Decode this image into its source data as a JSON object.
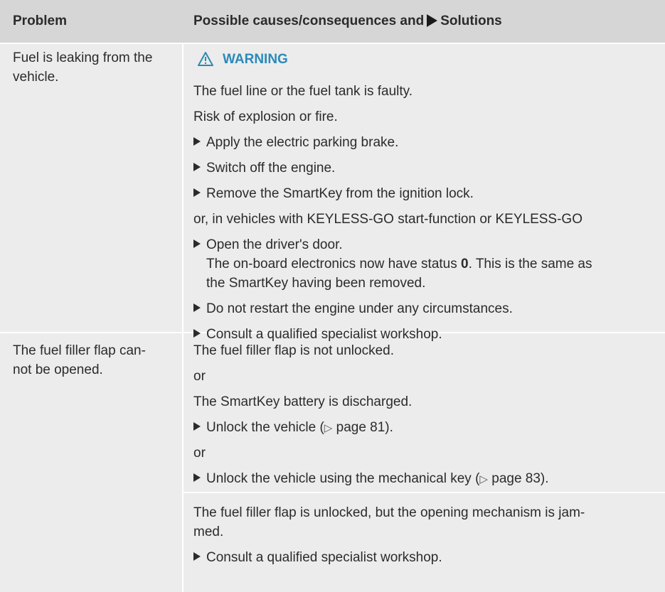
{
  "header": {
    "problem": "Problem",
    "solutions_prefix": "Possible causes/consequences and",
    "solutions_suffix": "Solutions"
  },
  "row1": {
    "problem_line1": "Fuel is leaking from the",
    "problem_line2": "vehicle.",
    "warning": "WARNING",
    "cause": "The fuel line or the fuel tank is faulty.",
    "risk": "Risk of explosion or fire.",
    "step1": "Apply the electric parking brake.",
    "step2": "Switch off the engine.",
    "step3": "Remove the SmartKey from the ignition lock.",
    "alt": "or, in vehicles with KEYLESS-GO start-function or KEYLESS-GO",
    "step4": "Open the driver's door.",
    "note_a": "The on-board electronics now have status ",
    "note_status": "0",
    "note_b": ". This is the same as",
    "note_c": "the SmartKey having been removed.",
    "step5": "Do not restart the engine under any circumstances.",
    "step6": "Consult a qualified specialist workshop."
  },
  "row2": {
    "problem_line1": "The fuel filler flap can-",
    "problem_line2": "not be opened.",
    "cause1": "The fuel filler flap is not unlocked.",
    "or1": "or",
    "cause2": "The SmartKey battery is discharged.",
    "step1_text": "Unlock the vehicle (",
    "page_ref_symbol": "▷",
    "step1_page": " page 81).",
    "or2": "or",
    "step2_text": "Unlock the vehicle using the mechanical key (",
    "step2_page": " page 83).",
    "cause3_line1": "The fuel filler flap is unlocked, but the opening mechanism is jam-",
    "cause3_line2": "med.",
    "step3": "Consult a qualified specialist workshop."
  }
}
